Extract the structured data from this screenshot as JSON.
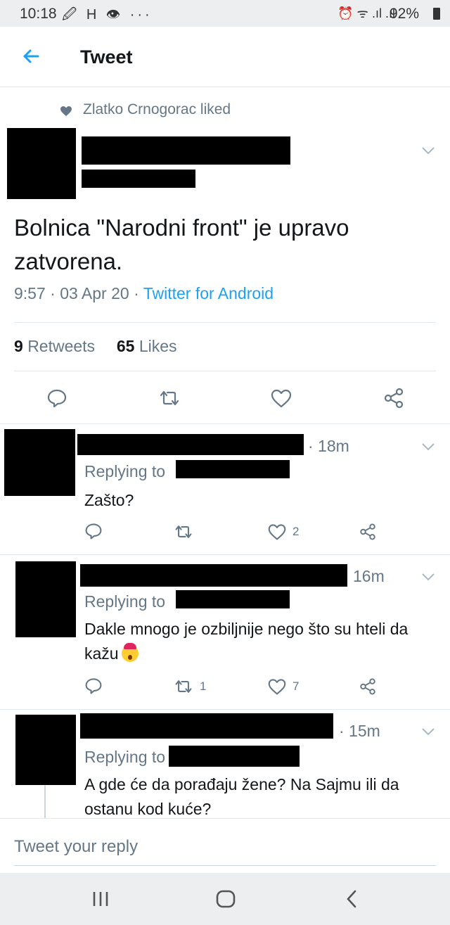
{
  "status_bar": {
    "time": "10:18",
    "notification_icons": "🖉 H 👁 ···",
    "battery": "92%"
  },
  "header": {
    "title": "Tweet"
  },
  "main_tweet": {
    "liked_by": "Zlatko Crnogorac liked",
    "text": "Bolnica \"Narodni front\" je upravo zatvorena.",
    "time": "9:57",
    "date": "03 Apr 20",
    "source": "Twitter for Android",
    "retweets_count": "9",
    "retweets_label": "Retweets",
    "likes_count": "65",
    "likes_label": "Likes"
  },
  "replies": [
    {
      "time": "· 18m",
      "replying_prefix": "Replying to",
      "text": "Zašto?",
      "retweets": "",
      "likes": "2"
    },
    {
      "time": "16m",
      "replying_prefix": "Replying to",
      "text": "Dakle mnogo je ozbiljnije nego što su hteli da kažu",
      "retweets": "1",
      "likes": "7"
    },
    {
      "time": "· 15m",
      "replying_prefix": "Replying to",
      "text": "A gde će da porađaju žene? Na Sajmu ili da ostanu kod kuće?"
    }
  ],
  "reply_box": {
    "placeholder": "Tweet your reply"
  },
  "colors": {
    "accent": "#1da1f2",
    "secondary_text": "#657786",
    "primary_text": "#14171a",
    "divider": "#e1e8ed"
  }
}
